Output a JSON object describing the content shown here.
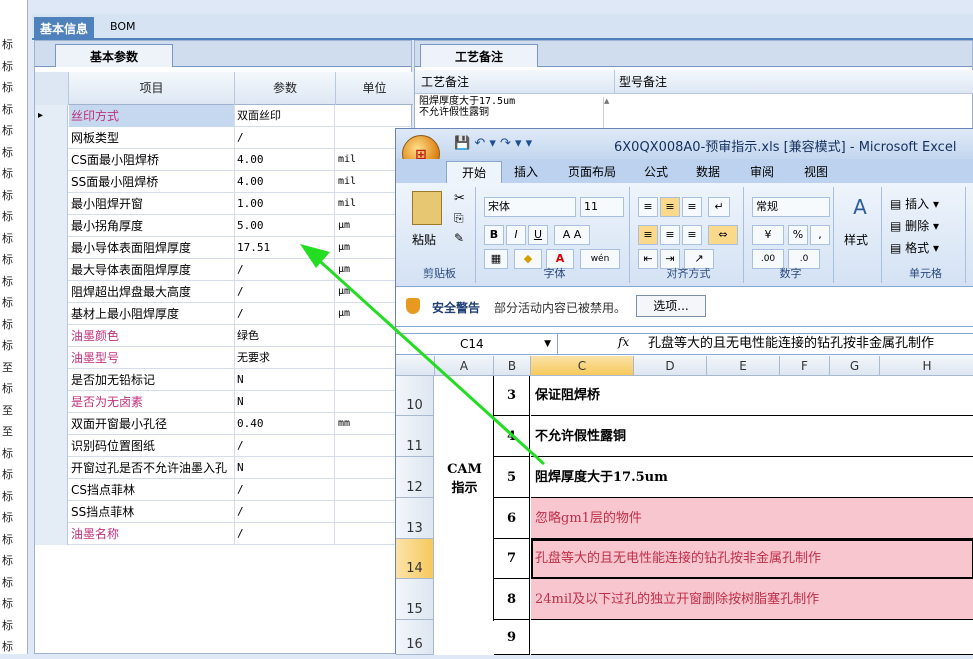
{
  "left_strip": [
    "标",
    "标",
    "标",
    "标",
    "标",
    "标",
    "标",
    "标",
    "标",
    "标",
    "标",
    "标",
    "标",
    "标",
    "标",
    "至",
    "标",
    "至",
    "至",
    "标",
    "标",
    "标",
    "标",
    "标",
    "标",
    "标",
    "标",
    "标",
    "标"
  ],
  "top_tabs": [
    {
      "label": "基本信息"
    },
    {
      "label": "BOM"
    }
  ],
  "param_panel": {
    "tab_label": "基本参数",
    "headers": [
      "项目",
      "参数",
      "单位"
    ],
    "rows": [
      {
        "item": "丝印方式",
        "value": "双面丝印",
        "unit": ""
      },
      {
        "item": "网板类型",
        "value": "/",
        "unit": ""
      },
      {
        "item": "CS面最小阻焊桥",
        "value": "4.00",
        "unit": "mil"
      },
      {
        "item": "SS面最小阻焊桥",
        "value": "4.00",
        "unit": "mil"
      },
      {
        "item": "最小阻焊开窗",
        "value": "1.00",
        "unit": "mil"
      },
      {
        "item": "最小拐角厚度",
        "value": "5.00",
        "unit": "μm"
      },
      {
        "item": "最小导体表面阻焊厚度",
        "value": "17.51",
        "unit": "μm"
      },
      {
        "item": "最大导体表面阻焊厚度",
        "value": "/",
        "unit": "μm"
      },
      {
        "item": "阻焊超出焊盘最大高度",
        "value": "/",
        "unit": "μm"
      },
      {
        "item": "基材上最小阻焊厚度",
        "value": "/",
        "unit": "μm"
      },
      {
        "item": "油墨颜色",
        "value": "绿色",
        "unit": ""
      },
      {
        "item": "油墨型号",
        "value": "无要求",
        "unit": ""
      },
      {
        "item": "是否加无铅标记",
        "value": "N",
        "unit": ""
      },
      {
        "item": "是否为无卤素",
        "value": "N",
        "unit": ""
      },
      {
        "item": "双面开窗最小孔径",
        "value": "0.40",
        "unit": "mm"
      },
      {
        "item": "识别码位置图纸",
        "value": "/",
        "unit": ""
      },
      {
        "item": "开窗过孔是否不允许油墨入孔",
        "value": "N",
        "unit": ""
      },
      {
        "item": "CS挡点菲林",
        "value": "/",
        "unit": ""
      },
      {
        "item": "SS挡点菲林",
        "value": "/",
        "unit": ""
      },
      {
        "item": "油墨名称",
        "value": "/",
        "unit": ""
      }
    ]
  },
  "notes_panel": {
    "tab_label": "工艺备注",
    "headers": [
      "工艺备注",
      "型号备注"
    ],
    "text_line1": "阻焊厚度大于17.5um",
    "text_line2": "不允许假性露铜"
  },
  "excel": {
    "title": "6X0QX008A0-预审指示.xls [兼容模式] - Microsoft Excel",
    "tabs": [
      "开始",
      "插入",
      "页面布局",
      "公式",
      "数据",
      "审阅",
      "视图"
    ],
    "ribbon": {
      "clipboard": {
        "paste": "粘贴",
        "label": "剪贴板"
      },
      "font": {
        "name": "宋体",
        "size": "11",
        "label": "字体"
      },
      "align": {
        "label": "对齐方式"
      },
      "number": {
        "format": "常规",
        "label": "数字"
      },
      "style": {
        "label": "样式"
      },
      "cells": {
        "insert": "插入",
        "delete": "删除",
        "format": "格式",
        "label": "单元格"
      }
    },
    "security": {
      "title": "安全警告",
      "message": "部分活动内容已被禁用。",
      "options": "选项..."
    },
    "name_box": "C14",
    "formula": "孔盘等大的且无电性能连接的钻孔按非金属孔制作",
    "columns": [
      "A",
      "B",
      "C",
      "D",
      "E",
      "F",
      "G",
      "H"
    ],
    "merged_label_line1": "CAM",
    "merged_label_line2": "指示",
    "rows": [
      {
        "row": "10",
        "num": "3",
        "text": "保证阻焊桥",
        "pink": false,
        "bold": true
      },
      {
        "row": "11",
        "num": "4",
        "text": "不允许假性露铜",
        "pink": false,
        "bold": true
      },
      {
        "row": "12",
        "num": "5",
        "text": "阻焊厚度大于17.5um",
        "pink": false,
        "bold": true
      },
      {
        "row": "13",
        "num": "6",
        "text": "忽略gm1层的物件",
        "pink": true,
        "bold": false
      },
      {
        "row": "14",
        "num": "7",
        "text": "孔盘等大的且无电性能连接的钻孔按非金属孔制作",
        "pink": true,
        "bold": false
      },
      {
        "row": "15",
        "num": "8",
        "text": "24mil及以下过孔的独立开窗删除按树脂塞孔制作",
        "pink": true,
        "bold": false
      },
      {
        "row": "16",
        "num": "9",
        "text": "",
        "pink": false,
        "bold": false
      }
    ]
  },
  "colors": {
    "accent": "#4f81bd",
    "arrow": "#22dd22",
    "pink_fill": "#f7c6cf",
    "pink_text": "#c0304a"
  }
}
